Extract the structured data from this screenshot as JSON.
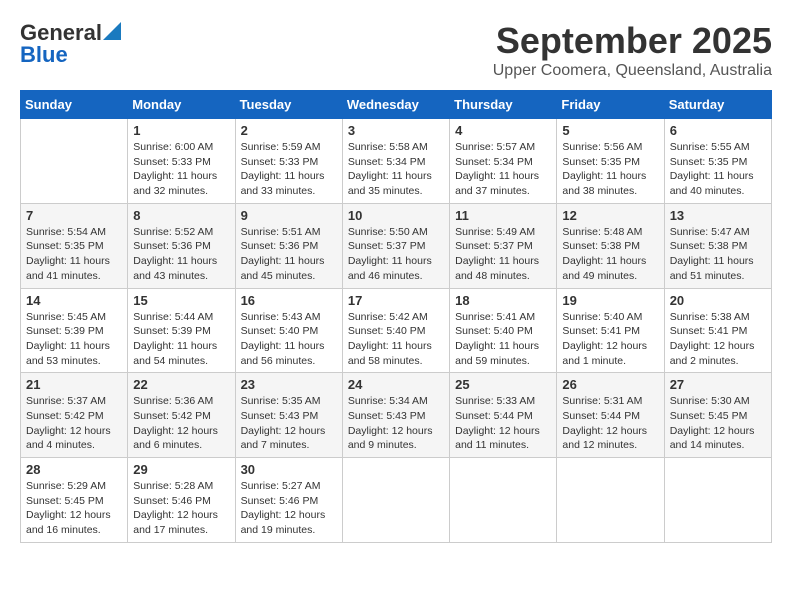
{
  "logo": {
    "general": "General",
    "blue": "Blue"
  },
  "header": {
    "month": "September 2025",
    "location": "Upper Coomera, Queensland, Australia"
  },
  "weekdays": [
    "Sunday",
    "Monday",
    "Tuesday",
    "Wednesday",
    "Thursday",
    "Friday",
    "Saturday"
  ],
  "weeks": [
    [
      {
        "day": "",
        "info": ""
      },
      {
        "day": "1",
        "info": "Sunrise: 6:00 AM\nSunset: 5:33 PM\nDaylight: 11 hours\nand 32 minutes."
      },
      {
        "day": "2",
        "info": "Sunrise: 5:59 AM\nSunset: 5:33 PM\nDaylight: 11 hours\nand 33 minutes."
      },
      {
        "day": "3",
        "info": "Sunrise: 5:58 AM\nSunset: 5:34 PM\nDaylight: 11 hours\nand 35 minutes."
      },
      {
        "day": "4",
        "info": "Sunrise: 5:57 AM\nSunset: 5:34 PM\nDaylight: 11 hours\nand 37 minutes."
      },
      {
        "day": "5",
        "info": "Sunrise: 5:56 AM\nSunset: 5:35 PM\nDaylight: 11 hours\nand 38 minutes."
      },
      {
        "day": "6",
        "info": "Sunrise: 5:55 AM\nSunset: 5:35 PM\nDaylight: 11 hours\nand 40 minutes."
      }
    ],
    [
      {
        "day": "7",
        "info": "Sunrise: 5:54 AM\nSunset: 5:35 PM\nDaylight: 11 hours\nand 41 minutes."
      },
      {
        "day": "8",
        "info": "Sunrise: 5:52 AM\nSunset: 5:36 PM\nDaylight: 11 hours\nand 43 minutes."
      },
      {
        "day": "9",
        "info": "Sunrise: 5:51 AM\nSunset: 5:36 PM\nDaylight: 11 hours\nand 45 minutes."
      },
      {
        "day": "10",
        "info": "Sunrise: 5:50 AM\nSunset: 5:37 PM\nDaylight: 11 hours\nand 46 minutes."
      },
      {
        "day": "11",
        "info": "Sunrise: 5:49 AM\nSunset: 5:37 PM\nDaylight: 11 hours\nand 48 minutes."
      },
      {
        "day": "12",
        "info": "Sunrise: 5:48 AM\nSunset: 5:38 PM\nDaylight: 11 hours\nand 49 minutes."
      },
      {
        "day": "13",
        "info": "Sunrise: 5:47 AM\nSunset: 5:38 PM\nDaylight: 11 hours\nand 51 minutes."
      }
    ],
    [
      {
        "day": "14",
        "info": "Sunrise: 5:45 AM\nSunset: 5:39 PM\nDaylight: 11 hours\nand 53 minutes."
      },
      {
        "day": "15",
        "info": "Sunrise: 5:44 AM\nSunset: 5:39 PM\nDaylight: 11 hours\nand 54 minutes."
      },
      {
        "day": "16",
        "info": "Sunrise: 5:43 AM\nSunset: 5:40 PM\nDaylight: 11 hours\nand 56 minutes."
      },
      {
        "day": "17",
        "info": "Sunrise: 5:42 AM\nSunset: 5:40 PM\nDaylight: 11 hours\nand 58 minutes."
      },
      {
        "day": "18",
        "info": "Sunrise: 5:41 AM\nSunset: 5:40 PM\nDaylight: 11 hours\nand 59 minutes."
      },
      {
        "day": "19",
        "info": "Sunrise: 5:40 AM\nSunset: 5:41 PM\nDaylight: 12 hours\nand 1 minute."
      },
      {
        "day": "20",
        "info": "Sunrise: 5:38 AM\nSunset: 5:41 PM\nDaylight: 12 hours\nand 2 minutes."
      }
    ],
    [
      {
        "day": "21",
        "info": "Sunrise: 5:37 AM\nSunset: 5:42 PM\nDaylight: 12 hours\nand 4 minutes."
      },
      {
        "day": "22",
        "info": "Sunrise: 5:36 AM\nSunset: 5:42 PM\nDaylight: 12 hours\nand 6 minutes."
      },
      {
        "day": "23",
        "info": "Sunrise: 5:35 AM\nSunset: 5:43 PM\nDaylight: 12 hours\nand 7 minutes."
      },
      {
        "day": "24",
        "info": "Sunrise: 5:34 AM\nSunset: 5:43 PM\nDaylight: 12 hours\nand 9 minutes."
      },
      {
        "day": "25",
        "info": "Sunrise: 5:33 AM\nSunset: 5:44 PM\nDaylight: 12 hours\nand 11 minutes."
      },
      {
        "day": "26",
        "info": "Sunrise: 5:31 AM\nSunset: 5:44 PM\nDaylight: 12 hours\nand 12 minutes."
      },
      {
        "day": "27",
        "info": "Sunrise: 5:30 AM\nSunset: 5:45 PM\nDaylight: 12 hours\nand 14 minutes."
      }
    ],
    [
      {
        "day": "28",
        "info": "Sunrise: 5:29 AM\nSunset: 5:45 PM\nDaylight: 12 hours\nand 16 minutes."
      },
      {
        "day": "29",
        "info": "Sunrise: 5:28 AM\nSunset: 5:46 PM\nDaylight: 12 hours\nand 17 minutes."
      },
      {
        "day": "30",
        "info": "Sunrise: 5:27 AM\nSunset: 5:46 PM\nDaylight: 12 hours\nand 19 minutes."
      },
      {
        "day": "",
        "info": ""
      },
      {
        "day": "",
        "info": ""
      },
      {
        "day": "",
        "info": ""
      },
      {
        "day": "",
        "info": ""
      }
    ]
  ]
}
